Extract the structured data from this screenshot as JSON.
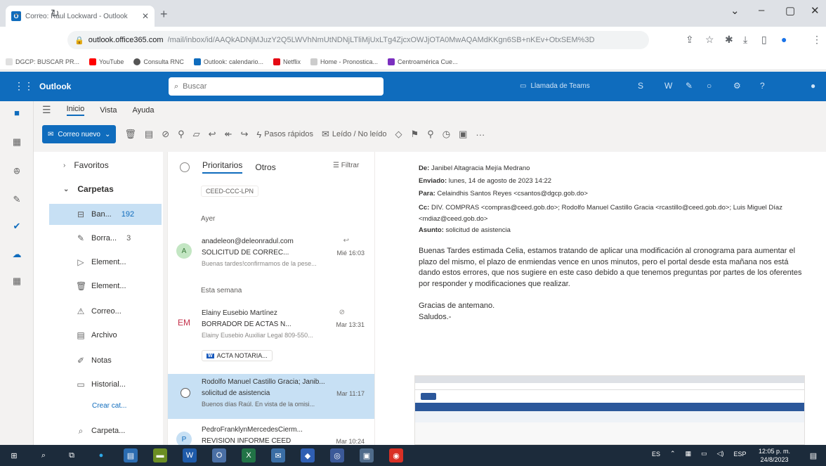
{
  "browser": {
    "tab_title": "Correo: Raul Lockward - Outlook",
    "tab_favicon": "O",
    "new_tab": "+",
    "url_host": "outlook.office365.com",
    "url_path": "/mail/inbox/id/AAQkADNjMJuzY2Q5LWVhNmUtNDNjLTliMjUxLTg4ZjcxOWJjOTA0MwAQAMdKKgn6SB+nKEv+OtxSEM%3D",
    "bookmarks": [
      {
        "label": "DGCP: BUSCAR PR...",
        "color": "#e0e0e0"
      },
      {
        "label": "YouTube",
        "color": "#ff0000"
      },
      {
        "label": "Consulta RNC",
        "color": "#555555"
      },
      {
        "label": "Outlook: calendario...",
        "color": "#0f6cbd"
      },
      {
        "label": "Netflix",
        "color": "#e50914"
      },
      {
        "label": "Home - Pronostica...",
        "color": "#cccccc"
      },
      {
        "label": "Centroamérica Cue...",
        "color": "#7b2fbf"
      }
    ]
  },
  "outlook": {
    "brand": "Outlook",
    "search_placeholder": "Buscar",
    "teams_label": "Llamada de Teams",
    "ribbon_tabs": [
      "Inicio",
      "Vista",
      "Ayuda"
    ],
    "ribbon": {
      "new_mail": "Correo nuevo",
      "quick_steps": "Pasos rápidos",
      "read_unread": "Leído / No leído"
    },
    "folders": {
      "favorites": "Favoritos",
      "folders": "Carpetas",
      "items": [
        {
          "icon": "inbox-icon",
          "glyph": "⊟",
          "label": "Ban...",
          "count": "192"
        },
        {
          "icon": "drafts-icon",
          "glyph": "✎",
          "label": "Borra...",
          "count": "3"
        },
        {
          "icon": "sent-icon",
          "glyph": "▷",
          "label": "Element...",
          "count": ""
        },
        {
          "icon": "deleted-icon",
          "glyph": "🗑",
          "label": "Element...",
          "count": ""
        },
        {
          "icon": "junk-icon",
          "glyph": "⚠",
          "label": "Correo...",
          "count": ""
        },
        {
          "icon": "archive-icon",
          "glyph": "▤",
          "label": "Archivo",
          "count": ""
        },
        {
          "icon": "notes-icon",
          "glyph": "✐",
          "label": "Notas",
          "count": ""
        },
        {
          "icon": "history-icon",
          "glyph": "▭",
          "label": "Historial...",
          "count": ""
        }
      ],
      "create_category": "Crear cat...",
      "search_folder": "Carpeta..."
    },
    "list": {
      "pivot_focused": "Prioritarios",
      "pivot_other": "Otros",
      "filter": "Filtrar",
      "tag": "CEED-CCC-LPN",
      "group_yesterday": "Ayer",
      "group_week": "Esta semana",
      "messages": [
        {
          "avatar": "A",
          "from": "anadeleon@deleonradul.com",
          "subject": "SOLICITUD DE CORREC...",
          "date": "Mié 16:03",
          "preview": "Buenas tardes!confirmamos de la pese..."
        },
        {
          "avatar": "EM",
          "from": "Elainy Eusebio Martínez",
          "subject": "BORRADOR DE ACTAS N...",
          "date": "Mar 13:31",
          "preview": "Elainy Eusebio Auxiliar Legal 809-550...",
          "attachment": "ACTA NOTARIA..."
        },
        {
          "avatar": "",
          "from": "Rodolfo Manuel Castillo Gracia; Janib...",
          "subject": "solicitud de asistencia",
          "date": "Mar 11:17",
          "preview": "Buenos días Raúl. En vista de la omisi..."
        },
        {
          "avatar": "P",
          "from": "PedroFranklynMercedesCierm...",
          "subject": "REVISION INFORME CEED",
          "date": "Mar 10:24",
          "preview": ""
        }
      ]
    },
    "reading": {
      "from_label": "De:",
      "from": "Janibel Altagracia Mejía Medrano",
      "sent_label": "Enviado:",
      "sent": "lunes, 14 de agosto de 2023 14:22",
      "to_label": "Para:",
      "to": "Celaindhis Santos Reyes <csantos@dgcp.gob.do>",
      "cc_label": "Cc:",
      "cc": "DIV. COMPRAS <compras@ceed.gob.do>; Rodolfo Manuel Castillo Gracia <rcastillo@ceed.gob.do>; Luis Miguel Díaz <mdiaz@ceed.gob.do>",
      "subject_label": "Asunto:",
      "subject": "solicitud de asistencia",
      "body_p1": "Buenas Tardes estimada Celia, estamos tratando de aplicar una modificación al cronograma para aumentar el plazo del mismo, el plazo de enmiendas vence en unos minutos, pero el portal desde esta mañana nos está dando estos errores, que nos sugiere en este caso debido a que tenemos preguntas por partes de los oferentes por responder y modificaciones que realizar.",
      "body_p2": "Gracias de antemano.",
      "body_p3": "Saludos.-"
    }
  },
  "taskbar": {
    "lang": "ES",
    "layout": "ESP",
    "time": "12:05 p. m.",
    "date": "24/8/2023"
  }
}
